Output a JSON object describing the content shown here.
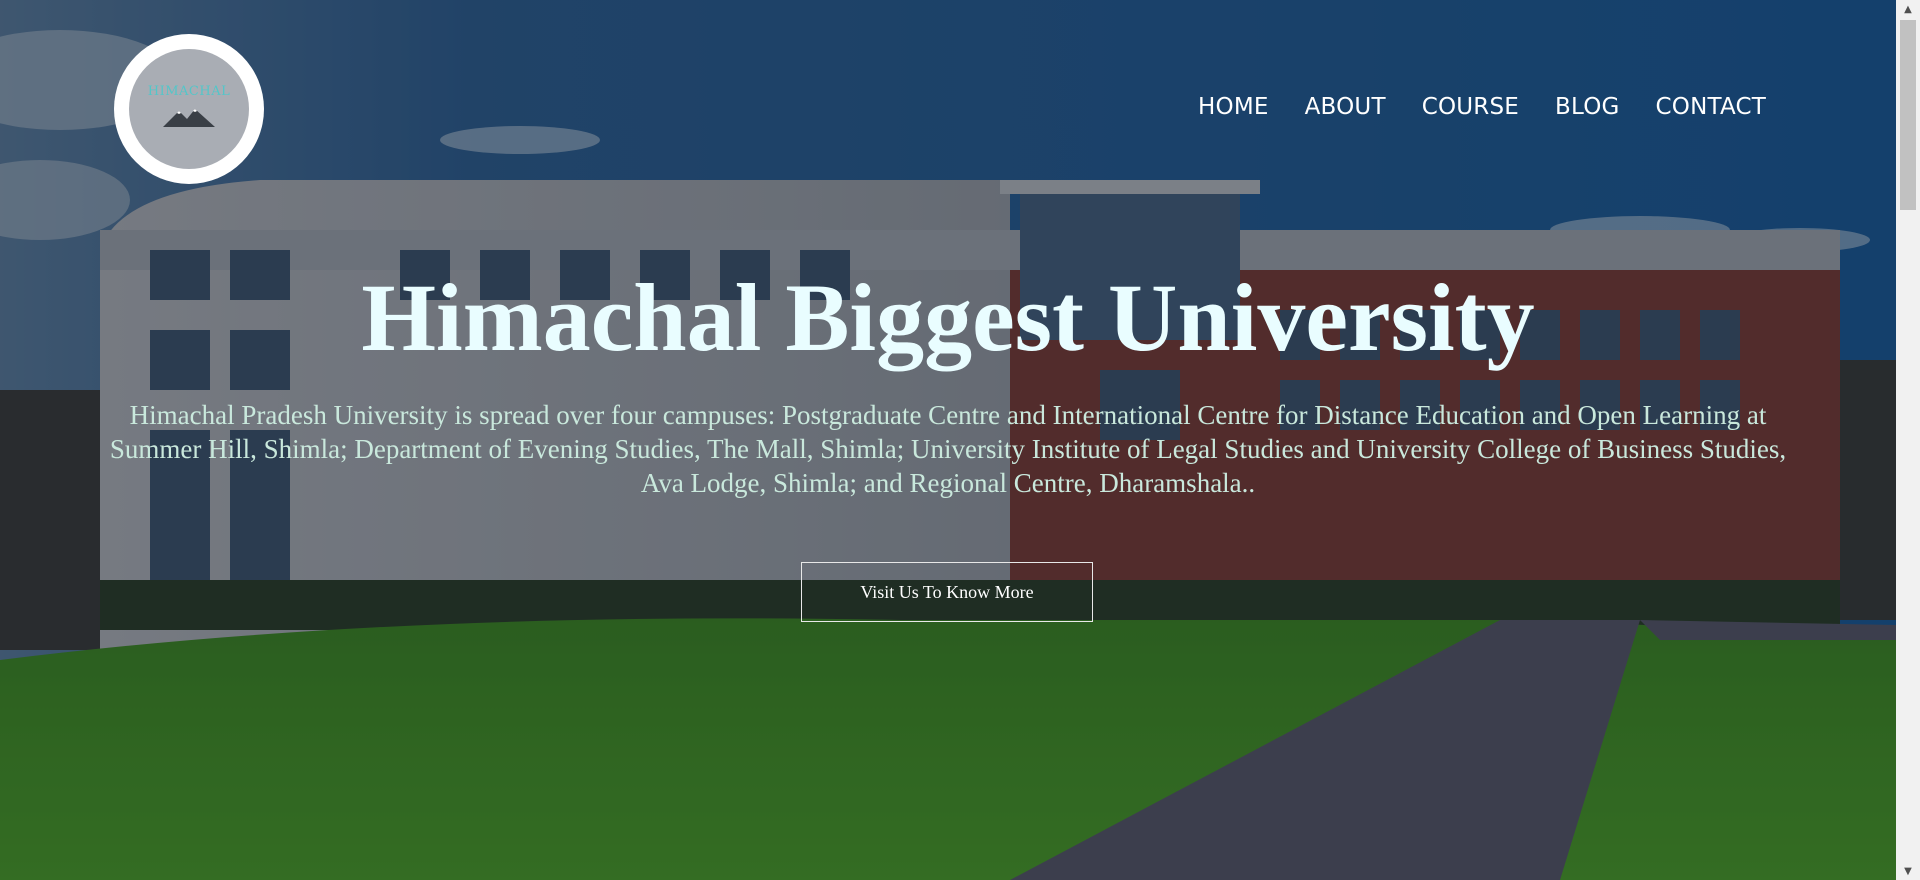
{
  "logo": {
    "text": "HIMACHAL"
  },
  "nav": {
    "items": [
      {
        "label": "HOME"
      },
      {
        "label": "ABOUT"
      },
      {
        "label": "COURSE"
      },
      {
        "label": "BLOG"
      },
      {
        "label": "CONTACT"
      }
    ]
  },
  "hero": {
    "title": "Himachal Biggest University",
    "description": "Himachal Pradesh University is spread over four campuses: Postgraduate Centre and International Centre for Distance Education and Open Learning at Summer Hill, Shimla; Department of Evening Studies, The Mall, Shimla; University Institute of Legal Studies and University College of Business Studies, Ava Lodge, Shimla; and Regional Centre, Dharamshala..",
    "button_label": "Visit Us To Know More"
  },
  "colors": {
    "title": "#e9fdff",
    "description": "#c9e8dc",
    "logo_text": "#53c6c9",
    "nav_text": "#ffffff"
  }
}
